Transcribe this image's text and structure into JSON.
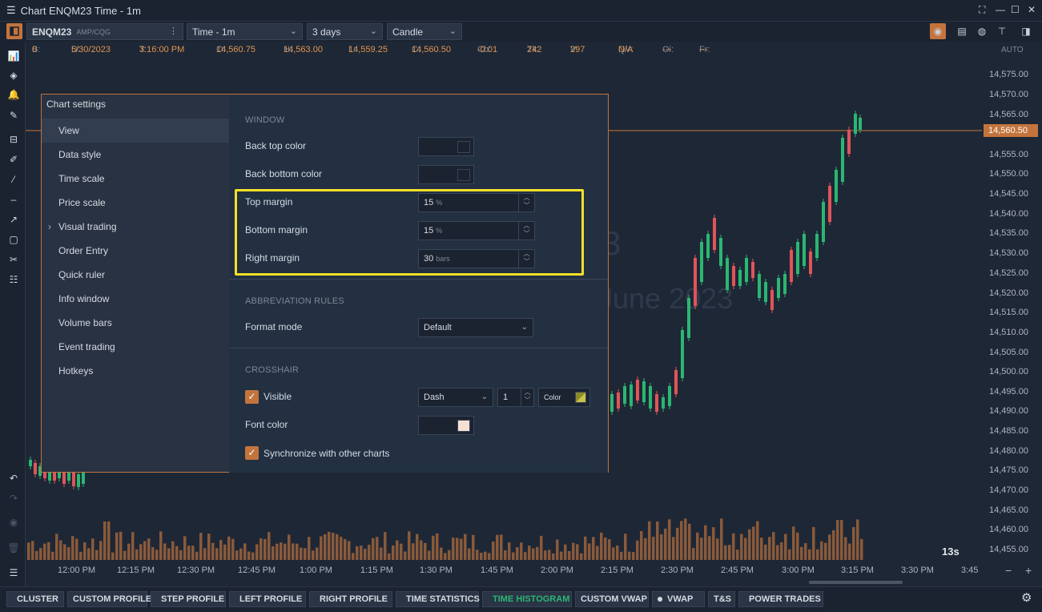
{
  "window": {
    "title": "Chart ENQM23 Time - 1m",
    "controls": [
      "⛶",
      "—",
      "☐",
      "✕"
    ]
  },
  "toolbar": {
    "symbol": "ENQM23",
    "symbol_source": "AMP/CQG",
    "timeframe": "Time - 1m",
    "period": "3 days",
    "chart_type": "Candle"
  },
  "infobar": {
    "B": {
      "label": "B:",
      "value": "0"
    },
    "D": {
      "label": "D:",
      "value": "5/30/2023"
    },
    "T": {
      "label": "T:",
      "value": "3:16:00 PM"
    },
    "O": {
      "label": "O:",
      "value": "14,560.75"
    },
    "H": {
      "label": "H:",
      "value": "14,563.00"
    },
    "L": {
      "label": "L:",
      "value": "14,559.25"
    },
    "C": {
      "label": "C:",
      "value": "14,560.50"
    },
    "Ch": {
      "label": "Ch:",
      "value": "-0.01"
    },
    "Tk": {
      "label": "Tk:",
      "value": "242"
    },
    "V": {
      "label": "V:",
      "value": "297"
    },
    "QV": {
      "label": "QV:",
      "value": "N/A"
    },
    "Oi": {
      "label": "Oi:",
      "value": "---"
    },
    "Fr": {
      "label": "Fr:",
      "value": "---"
    },
    "auto": "AUTO"
  },
  "price_axis": {
    "labels": [
      "14,575.00",
      "14,570.00",
      "14,565.00",
      "14,555.00",
      "14,550.00",
      "14,545.00",
      "14,540.00",
      "14,535.00",
      "14,530.00",
      "14,525.00",
      "14,520.00",
      "14,515.00",
      "14,510.00",
      "14,505.00",
      "14,500.00",
      "14,495.00",
      "14,490.00",
      "14,485.00",
      "14,480.00",
      "14,475.00",
      "14,470.00",
      "14,465.00",
      "14,460.00",
      "14,455.00"
    ],
    "current_price": "14,560.50"
  },
  "time_axis": {
    "labels": [
      "12:00 PM",
      "12:15 PM",
      "12:30 PM",
      "12:45 PM",
      "1:00 PM",
      "1:15 PM",
      "1:30 PM",
      "1:45 PM",
      "2:00 PM",
      "2:15 PM",
      "2:30 PM",
      "2:45 PM",
      "3:00 PM",
      "3:15 PM",
      "3:30 PM",
      "3:45"
    ]
  },
  "chart": {
    "timer": "13s",
    "watermark_symbol": "3",
    "watermark_date": "June 2023"
  },
  "bottom_tabs": [
    {
      "label": "CLUSTER",
      "dot": true,
      "active": false
    },
    {
      "label": "CUSTOM PROFILE",
      "dot": false,
      "active": false
    },
    {
      "label": "STEP PROFILE",
      "dot": true,
      "active": false
    },
    {
      "label": "LEFT PROFILE",
      "dot": true,
      "active": false
    },
    {
      "label": "RIGHT PROFILE",
      "dot": true,
      "active": false
    },
    {
      "label": "TIME STATISTICS",
      "dot": true,
      "active": false
    },
    {
      "label": "TIME HISTOGRAM",
      "dot": true,
      "active": true
    },
    {
      "label": "CUSTOM VWAP",
      "dot": false,
      "active": false
    },
    {
      "label": "VWAP",
      "dot": true,
      "active": false
    },
    {
      "label": "T&S",
      "dot": false,
      "active": false
    },
    {
      "label": "POWER TRADES",
      "dot": true,
      "active": false
    }
  ],
  "dialog": {
    "title": "Chart settings",
    "close": "✕",
    "nav": [
      {
        "label": "View",
        "selected": true,
        "expandable": false
      },
      {
        "label": "Data style",
        "selected": false,
        "expandable": false
      },
      {
        "label": "Time scale",
        "selected": false,
        "expandable": false
      },
      {
        "label": "Price scale",
        "selected": false,
        "expandable": false
      },
      {
        "label": "Visual trading",
        "selected": false,
        "expandable": true
      },
      {
        "label": "Order Entry",
        "selected": false,
        "expandable": false
      },
      {
        "label": "Quick ruler",
        "selected": false,
        "expandable": false
      },
      {
        "label": "Info window",
        "selected": false,
        "expandable": false
      },
      {
        "label": "Volume bars",
        "selected": false,
        "expandable": false
      },
      {
        "label": "Event trading",
        "selected": false,
        "expandable": false
      },
      {
        "label": "Hotkeys",
        "selected": false,
        "expandable": false
      }
    ],
    "window_section": {
      "heading": "WINDOW",
      "back_top_color": {
        "label": "Back top color",
        "color": "#1b2330"
      },
      "back_bottom_color": {
        "label": "Back bottom color",
        "color": "#1b2330"
      },
      "top_margin": {
        "label": "Top margin",
        "value": "15",
        "unit": "%"
      },
      "bottom_margin": {
        "label": "Bottom margin",
        "value": "15",
        "unit": "%"
      },
      "right_margin": {
        "label": "Right margin",
        "value": "30",
        "unit": "bars"
      }
    },
    "abbreviation_section": {
      "heading": "ABBREVIATION RULES",
      "format_mode": {
        "label": "Format mode",
        "value": "Default"
      }
    },
    "crosshair_section": {
      "heading": "CROSSHAIR",
      "visible": {
        "label": "Visible",
        "checked": true
      },
      "line_style": "Dash",
      "line_width": "1",
      "color_label": "Color",
      "font_color": {
        "label": "Font color",
        "color": "#f5e1d3"
      },
      "sync": {
        "label": "Synchronize with other charts",
        "checked": true
      }
    }
  },
  "colors": {
    "accent": "#c3743d",
    "up_candle": "#2bb673",
    "down_candle": "#e0545a",
    "volume": "#8a5a3a",
    "volume_highlight": "#2a86d8",
    "highlight_box": "#f5e02a"
  }
}
